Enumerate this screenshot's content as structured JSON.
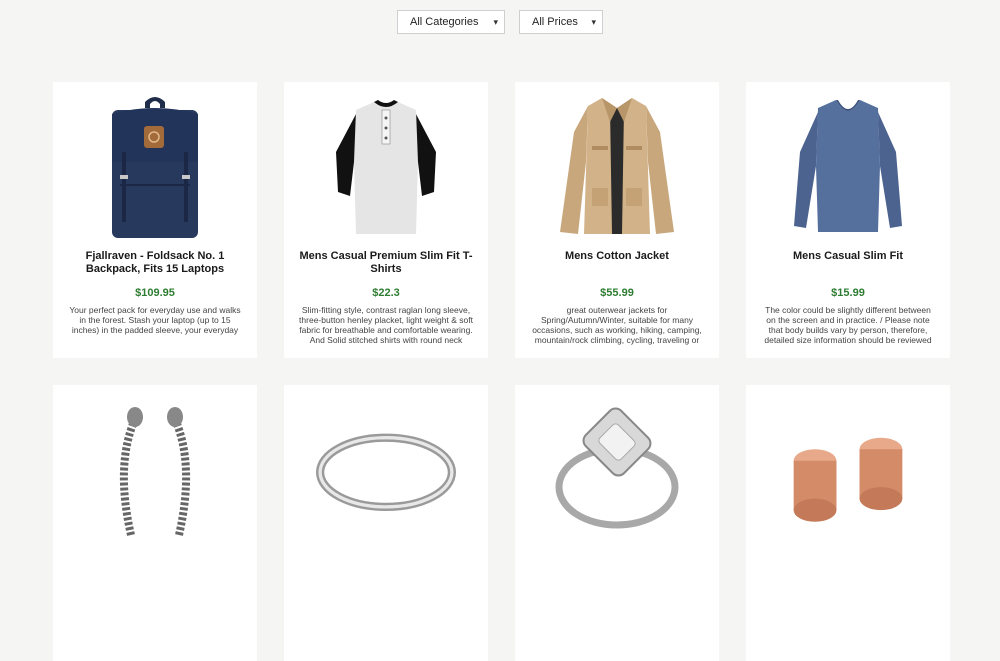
{
  "filters": {
    "category": "All Categories",
    "price": "All Prices"
  },
  "products": [
    {
      "title": "Fjallraven - Foldsack No. 1 Backpack, Fits 15 Laptops",
      "price": "$109.95",
      "description": "Your perfect pack for everyday use and walks in the forest. Stash your laptop (up to 15 inches) in the padded sleeve, your everyday",
      "icon": "backpack-icon"
    },
    {
      "title": "Mens Casual Premium Slim Fit T-Shirts",
      "price": "$22.3",
      "description": "Slim-fitting style, contrast raglan long sleeve, three-button henley placket, light weight & soft fabric for breathable and comfortable wearing. And Solid stitched shirts with round neck made",
      "icon": "henley-shirt-icon"
    },
    {
      "title": "Mens Cotton Jacket",
      "price": "$55.99",
      "description": "great outerwear jackets for Spring/Autumn/Winter, suitable for many occasions, such as working, hiking, camping, mountain/rock climbing, cycling, traveling or",
      "icon": "jacket-icon"
    },
    {
      "title": "Mens Casual Slim Fit",
      "price": "$15.99",
      "description": "The color could be slightly different between on the screen and in practice. / Please note that body builds vary by person, therefore, detailed size information should be reviewed",
      "icon": "long-sleeve-shirt-icon"
    },
    {
      "title": "",
      "price": "",
      "description": "",
      "icon": "bracelet-icon"
    },
    {
      "title": "",
      "price": "",
      "description": "",
      "icon": "silver-ring-icon"
    },
    {
      "title": "",
      "price": "",
      "description": "",
      "icon": "diamond-ring-icon"
    },
    {
      "title": "",
      "price": "",
      "description": "",
      "icon": "rose-gold-earrings-icon"
    }
  ]
}
